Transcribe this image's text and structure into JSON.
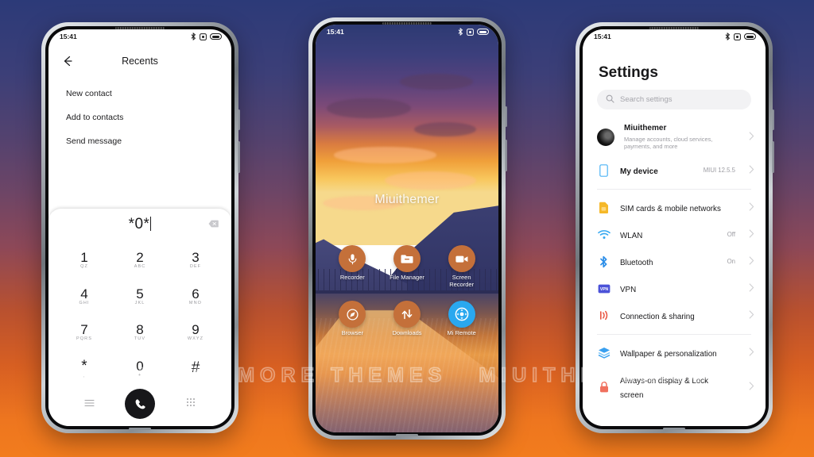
{
  "background": {
    "top_color": "#2c3a78",
    "bottom_color": "#f27c1d"
  },
  "watermark": {
    "left_text": "VISIT FOR MORE THEMES",
    "right_text": "MIUITHEMER.COM"
  },
  "statusbar": {
    "time": "15:41",
    "icons": [
      "bluetooth-icon",
      "alarm-icon",
      "battery-icon"
    ]
  },
  "phone1": {
    "name": "dialer-phone",
    "header": {
      "title": "Recents",
      "back_icon": "back-arrow-icon"
    },
    "menu_items": [
      {
        "label": "New contact"
      },
      {
        "label": "Add to contacts"
      },
      {
        "label": "Send message"
      }
    ],
    "dialer": {
      "entered_number": "*0*",
      "backspace_icon": "backspace-icon",
      "keys": [
        {
          "digit": "1",
          "letters": "QZ"
        },
        {
          "digit": "2",
          "letters": "ABC"
        },
        {
          "digit": "3",
          "letters": "DEF"
        },
        {
          "digit": "4",
          "letters": "GHI"
        },
        {
          "digit": "5",
          "letters": "JKL"
        },
        {
          "digit": "6",
          "letters": "MNO"
        },
        {
          "digit": "7",
          "letters": "PQRS"
        },
        {
          "digit": "8",
          "letters": "TUV"
        },
        {
          "digit": "9",
          "letters": "WXYZ"
        },
        {
          "digit": "*",
          "letters": ","
        },
        {
          "digit": "0",
          "letters": "+"
        },
        {
          "digit": "#",
          "letters": ""
        }
      ],
      "bottom_bar": {
        "menu_icon": "hamburger-menu-icon",
        "call_icon": "call-icon",
        "keypad_icon": "keypad-grid-icon",
        "call_button_color": "#17171a"
      }
    }
  },
  "phone2": {
    "name": "home-screen-phone",
    "wallpaper_label": "Miuithemer",
    "apps": [
      {
        "label": "Recorder",
        "icon": "microphone-icon",
        "color": "#c4703a"
      },
      {
        "label": "File Manager",
        "icon": "folder-icon",
        "color": "#c4703a"
      },
      {
        "label": "Screen Recorder",
        "icon": "video-camera-icon",
        "color": "#c4703a"
      },
      {
        "label": "Browser",
        "icon": "compass-icon",
        "color": "#c4703a"
      },
      {
        "label": "Downloads",
        "icon": "up-down-arrows-icon",
        "color": "#c4703a"
      },
      {
        "label": "Mi Remote",
        "icon": "remote-dpad-icon",
        "color": "#2aa8ef"
      }
    ]
  },
  "phone3": {
    "name": "settings-phone",
    "title": "Settings",
    "search": {
      "placeholder": "Search settings",
      "icon": "search-icon"
    },
    "account": {
      "name": "Miuithemer",
      "subtitle": "Manage accounts, cloud services, payments, and more",
      "avatar": "avatar"
    },
    "device": {
      "label": "My device",
      "value": "MIUI 12.5.5",
      "icon": "phone-outline-icon"
    },
    "group1": [
      {
        "label": "SIM cards & mobile networks",
        "value": "",
        "icon": "sim-card-icon",
        "color": "#f5b829"
      },
      {
        "label": "WLAN",
        "value": "Off",
        "icon": "wifi-icon",
        "color": "#35a8f0"
      },
      {
        "label": "Bluetooth",
        "value": "On",
        "icon": "bluetooth-icon",
        "color": "#2e8fe8"
      },
      {
        "label": "VPN",
        "value": "",
        "icon": "vpn-badge-icon",
        "color": "#4b52d8"
      },
      {
        "label": "Connection & sharing",
        "value": "",
        "icon": "connection-sharing-icon",
        "color": "#e9533f"
      }
    ],
    "group2": [
      {
        "label": "Wallpaper & personalization",
        "value": "",
        "icon": "wallpaper-layers-icon",
        "color": "#3aa0ef"
      },
      {
        "label": "Always-on display & Lock screen",
        "value": "",
        "icon": "lock-icon",
        "color": "#f0705e"
      }
    ]
  }
}
